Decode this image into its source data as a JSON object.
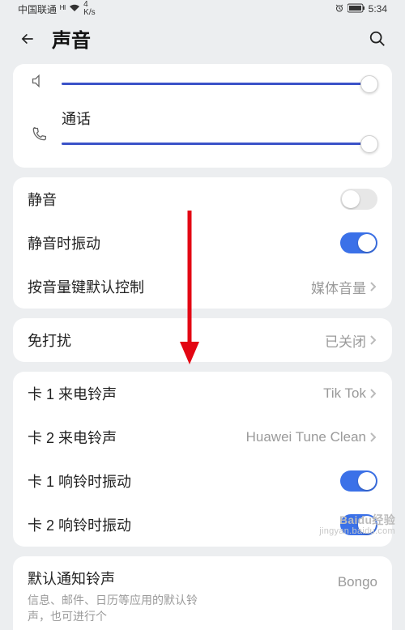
{
  "status": {
    "carrier": "中国联通",
    "net": "4\nK/s",
    "time": "5:34"
  },
  "header": {
    "title": "声音"
  },
  "sliders": {
    "call_label": "通话"
  },
  "section1": {
    "mute_label": "静音",
    "mute_on": false,
    "vibrate_mute_label": "静音时振动",
    "vibrate_mute_on": true,
    "volkey_label": "按音量键默认控制",
    "volkey_value": "媒体音量"
  },
  "section2": {
    "dnd_label": "免打扰",
    "dnd_value": "已关闭"
  },
  "section3": {
    "sim1_ring_label": "卡 1 来电铃声",
    "sim1_ring_value": "Tik Tok",
    "sim2_ring_label": "卡 2 来电铃声",
    "sim2_ring_value": "Huawei Tune Clean",
    "sim1_vib_label": "卡 1 响铃时振动",
    "sim1_vib_on": true,
    "sim2_vib_label": "卡 2 响铃时振动",
    "sim2_vib_on": true
  },
  "section4": {
    "title": "默认通知铃声",
    "desc": "信息、邮件、日历等应用的默认铃声，也可进行个",
    "value": "Bongo"
  },
  "watermark": {
    "brand": "Baidu经验",
    "sub": "jingyan.baidu.com"
  }
}
